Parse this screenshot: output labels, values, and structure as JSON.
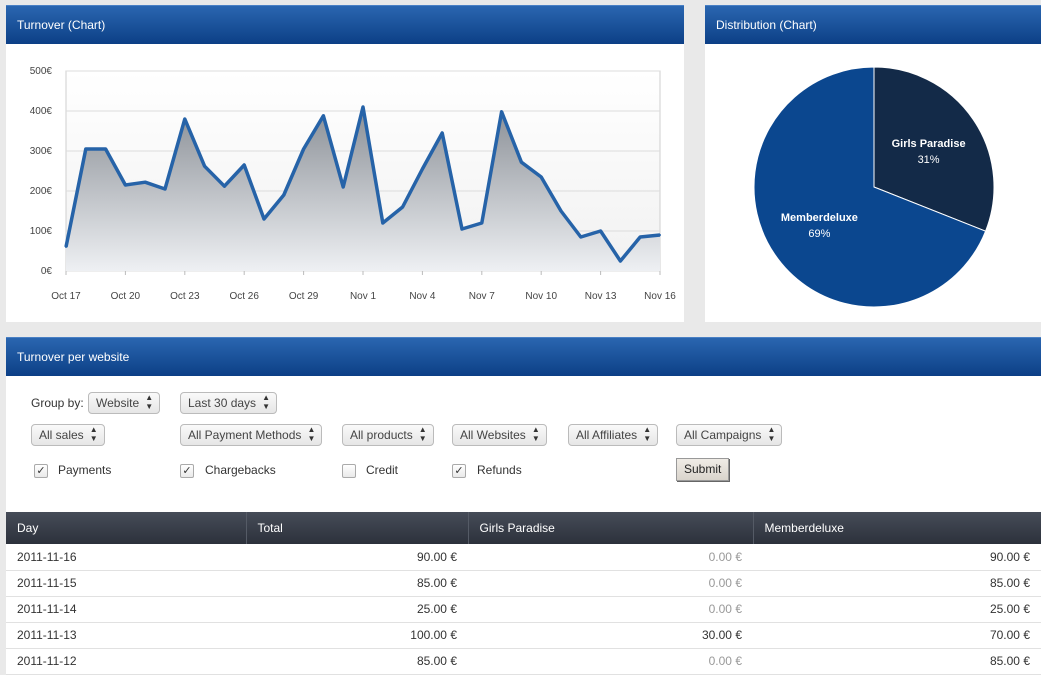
{
  "turnover_panel": {
    "title": "Turnover (Chart)"
  },
  "distribution_panel": {
    "title": "Distribution (Chart)"
  },
  "table_panel": {
    "title": "Turnover per website"
  },
  "chart_data": [
    {
      "type": "area",
      "y_tick_labels": [
        "500€",
        "400€",
        "300€",
        "200€",
        "100€",
        "0€"
      ],
      "y_ticks": [
        500,
        400,
        300,
        200,
        100,
        0
      ],
      "ylim": [
        0,
        500
      ],
      "x_tick_labels": [
        "Oct 17",
        "Oct 20",
        "Oct 23",
        "Oct 26",
        "Oct 29",
        "Nov 1",
        "Nov 4",
        "Nov 7",
        "Nov 10",
        "Nov 13",
        "Nov 16"
      ],
      "x_tick_index": [
        0,
        3,
        6,
        9,
        12,
        15,
        18,
        21,
        24,
        27,
        30
      ],
      "values": [
        60,
        305,
        305,
        215,
        222,
        205,
        380,
        262,
        212,
        265,
        130,
        190,
        305,
        388,
        210,
        410,
        120,
        160,
        255,
        345,
        105,
        120,
        398,
        272,
        235,
        150,
        85,
        100,
        25,
        85,
        90
      ],
      "grid": true,
      "colors": {
        "line": "#2663a8",
        "fill_top": "#8a8f96",
        "fill_bottom": "#eef0f3"
      }
    },
    {
      "type": "pie",
      "slices": [
        {
          "label": "Girls Paradise",
          "pct": "31%",
          "value": 31,
          "color": "#132a48"
        },
        {
          "label": "Memberdeluxe",
          "pct": "69%",
          "value": 69,
          "color": "#0b478f"
        }
      ]
    }
  ],
  "filters": {
    "group_by_label": "Group by:",
    "group_by": "Website",
    "period": "Last 30 days",
    "sales": "All sales",
    "payment_methods": "All Payment Methods",
    "products": "All products",
    "websites": "All Websites",
    "affiliates": "All Affiliates",
    "campaigns": "All Campaigns",
    "checkboxes": [
      {
        "label": "Payments",
        "checked": true
      },
      {
        "label": "Chargebacks",
        "checked": true
      },
      {
        "label": "Credit",
        "checked": false
      },
      {
        "label": "Refunds",
        "checked": true
      }
    ],
    "submit": "Submit"
  },
  "table": {
    "headers": [
      "Day",
      "Total",
      "Girls Paradise",
      "Memberdeluxe"
    ],
    "rows": [
      [
        "2011-11-16",
        "90.00 €",
        "0.00 €",
        "90.00 €"
      ],
      [
        "2011-11-15",
        "85.00 €",
        "0.00 €",
        "85.00 €"
      ],
      [
        "2011-11-14",
        "25.00 €",
        "0.00 €",
        "25.00 €"
      ],
      [
        "2011-11-13",
        "100.00 €",
        "30.00 €",
        "70.00 €"
      ],
      [
        "2011-11-12",
        "85.00 €",
        "0.00 €",
        "85.00 €"
      ]
    ]
  }
}
